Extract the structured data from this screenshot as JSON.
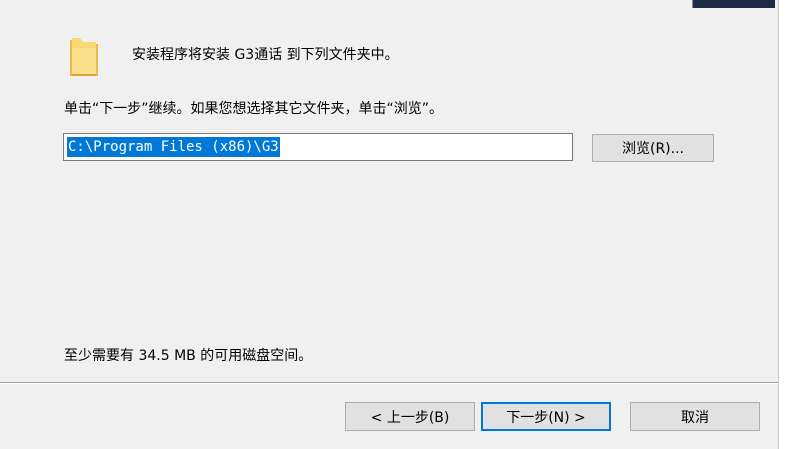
{
  "intro": {
    "text": "安装程序将安装 G3通话 到下列文件夹中。"
  },
  "instruction": {
    "text": "单击“下一步”继续。如果您想选择其它文件夹，单击“浏览”。"
  },
  "destination": {
    "path": "C:\\Program Files (x86)\\G3"
  },
  "browse_button": {
    "label": "浏览(R)..."
  },
  "disk_space": {
    "text": "至少需要有 34.5 MB 的可用磁盘空间。"
  },
  "footer": {
    "back_label": "< 上一步(B)",
    "next_label": "下一步(N) >",
    "cancel_label": "取消"
  },
  "icons": {
    "folder": "folder-icon"
  },
  "colors": {
    "selection": "#0078d7",
    "folder_yellow": "#f8d775",
    "dialog_background": "#f0f0f0"
  }
}
